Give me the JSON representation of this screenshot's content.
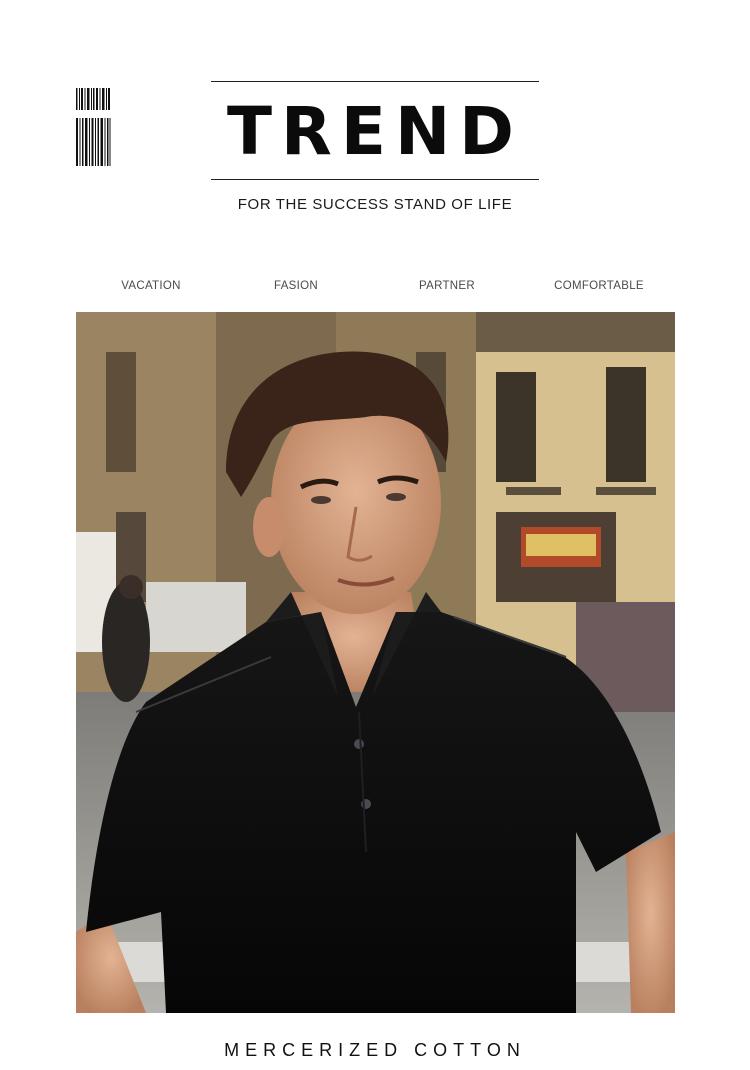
{
  "header": {
    "title": "TREND",
    "tagline": "FOR THE SUCCESS STAND OF LIFE"
  },
  "categories": [
    "VACATION",
    "FASION",
    "PARTNER",
    "COMFORTABLE"
  ],
  "footer": {
    "caption": "MERCERIZED COTTON"
  },
  "colors": {
    "background": "#ffffff",
    "text": "#111111",
    "shirt": "#0d0d0d",
    "building": "#d6c08f"
  }
}
